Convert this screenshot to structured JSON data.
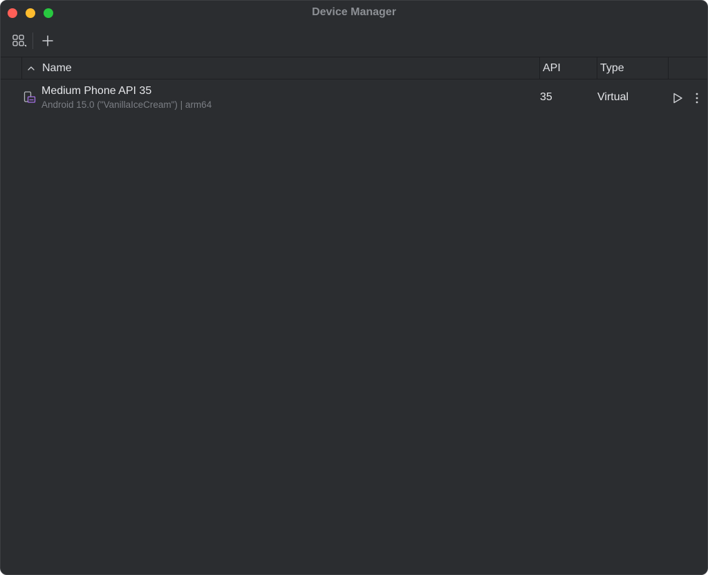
{
  "window": {
    "title": "Device Manager"
  },
  "toolbar": {
    "view_options_icon": "grid-view-icon",
    "add_icon": "plus-icon"
  },
  "table": {
    "columns": {
      "name": "Name",
      "api": "API",
      "type": "Type"
    },
    "sort": "ascending",
    "rows": [
      {
        "name": "Medium Phone API 35",
        "subtitle": "Android 15.0 (\"VanillaIceCream\") | arm64",
        "api": "35",
        "type": "Virtual",
        "icon": "virtual-device-icon",
        "actions": [
          "play-icon",
          "more-vertical-icon"
        ]
      }
    ]
  },
  "colors": {
    "background": "#2b2d30",
    "text": "#dfe1e5",
    "subtext": "#7b7e84",
    "device_icon_accent": "#a571e6",
    "close": "#ff5f57",
    "minimize": "#febc2e",
    "maximize": "#28c840"
  }
}
